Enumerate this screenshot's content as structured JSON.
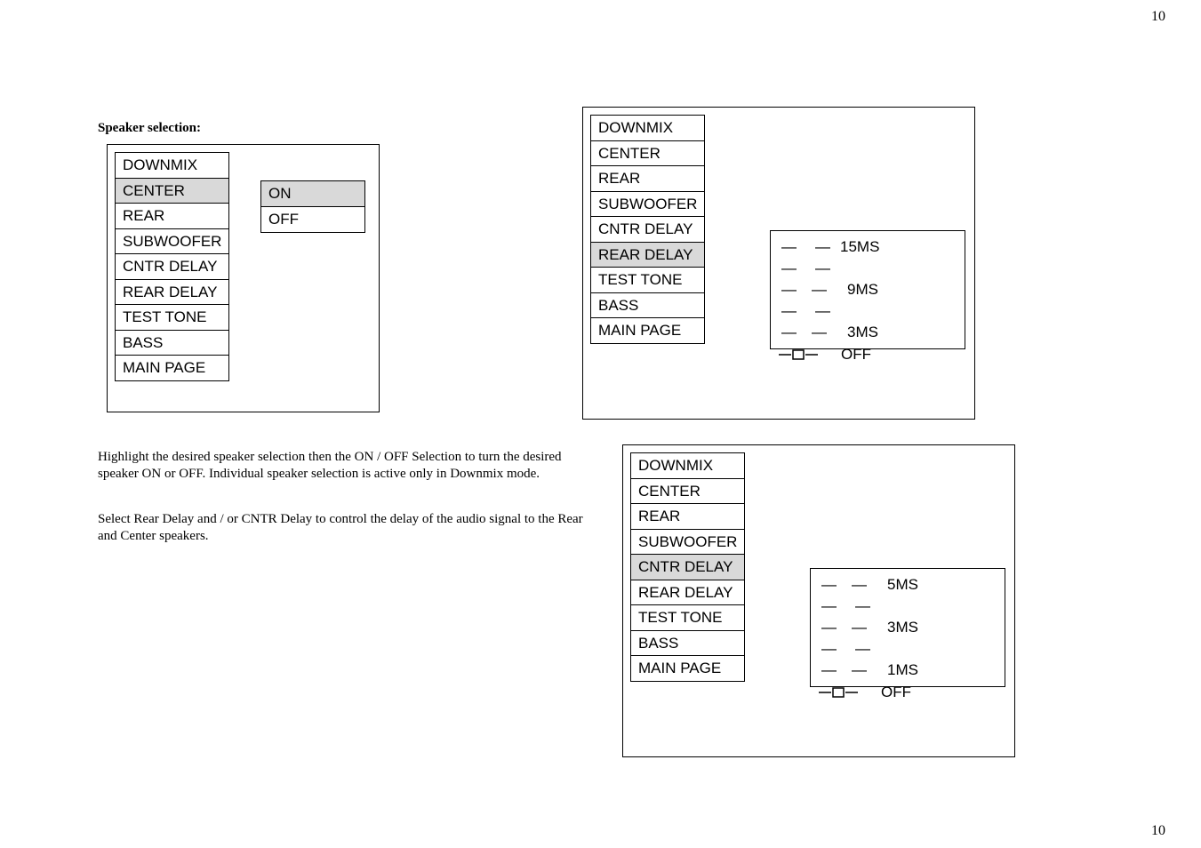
{
  "page_number": "10",
  "heading": "Speaker selection:",
  "text1": "Highlight the desired speaker selection then the ON / OFF Selection to turn the desired speaker ON or OFF.  Individual speaker selection is active only in Downmix mode.",
  "text2": "Select Rear Delay and / or CNTR Delay to control the delay of the audio signal to the Rear and Center speakers.",
  "menu": {
    "downmix": "DOWNMIX",
    "center": "CENTER",
    "rear": "REAR",
    "subwoofer": "SUBWOOFER",
    "cntr_delay": "CNTR DELAY",
    "rear_delay": "REAR DELAY",
    "test_tone": "TEST TONE",
    "bass": "BASS",
    "main_page": "MAIN PAGE"
  },
  "options": {
    "on": "ON",
    "off": "OFF"
  },
  "delay": {
    "ms15": "15MS",
    "ms9": "9MS",
    "ms5": "5MS",
    "ms3": "3MS",
    "ms1": "1MS",
    "off": "OFF"
  }
}
